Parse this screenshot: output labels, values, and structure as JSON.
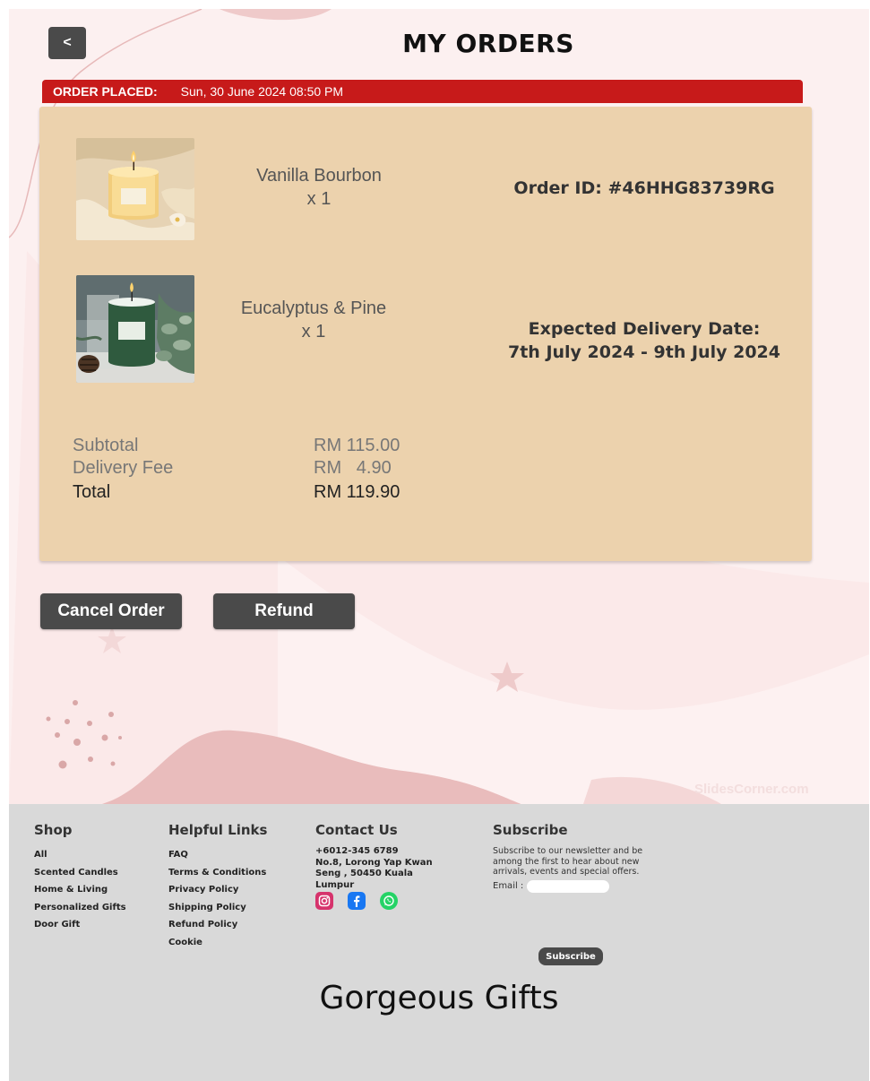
{
  "header": {
    "back_label": "<",
    "title": "MY ORDERS"
  },
  "order": {
    "placed_label": "ORDER PLACED:",
    "placed_at": "Sun, 30 June 2024  08:50 PM",
    "order_id": "Order ID: #46HHG83739RG",
    "delivery_label": "Expected Delivery Date:",
    "delivery_range": "7th July 2024 - 9th July 2024",
    "items": [
      {
        "name": "Vanilla Bourbon",
        "qty": "x 1"
      },
      {
        "name": "Eucalyptus & Pine",
        "qty": "x 1"
      }
    ],
    "summary": {
      "subtotal_label": "Subtotal",
      "subtotal": "RM 115.00",
      "delivery_label": "Delivery Fee",
      "delivery": "RM   4.90",
      "total_label": "Total",
      "total": "RM 119.90"
    }
  },
  "actions": {
    "cancel": "Cancel Order",
    "refund": "Refund"
  },
  "watermark": "SlidesCorner.com",
  "footer": {
    "shop": {
      "title": "Shop",
      "links": [
        "All",
        "Scented Candles",
        "Home & Living",
        "Personalized Gifts",
        "Door Gift"
      ]
    },
    "helpful": {
      "title": "Helpful Links",
      "links": [
        "FAQ",
        "Terms & Conditions",
        "Privacy Policy",
        "Shipping Policy",
        "Refund Policy",
        "Cookie"
      ]
    },
    "contact": {
      "title": "Contact Us",
      "phone": "+6012-345 6789",
      "address": "No.8, Lorong Yap Kwan Seng , 50450 Kuala Lumpur",
      "social_icons": [
        "instagram-icon",
        "facebook-icon",
        "whatsapp-icon"
      ]
    },
    "subscribe": {
      "title": "Subscribe",
      "text": "Subscribe to our newsletter and be among the first to hear about new arrivals, events and special offers.",
      "email_label": "Email :",
      "email_value": "",
      "button": "Subscribe"
    },
    "brand": "Gorgeous Gifts"
  },
  "colors": {
    "accent_red": "#c71a1a",
    "card": "#ecd2ad",
    "button": "#4a4a4a",
    "page_bg": "#fcf0f0",
    "footer_bg": "#d9d9d9"
  }
}
